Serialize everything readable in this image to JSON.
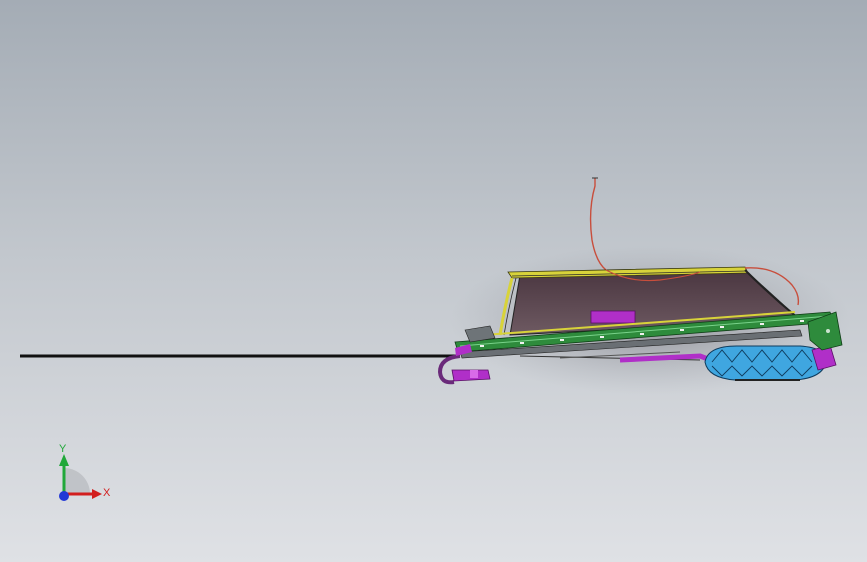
{
  "viewport": {
    "background_top": "#a4acb5",
    "background_bottom": "#dfe1e5"
  },
  "model": {
    "description_icon": "rope-winch-assembly",
    "colors": {
      "rail_yellow": "#d8d33a",
      "rail_green": "#2e8b3c",
      "purple": "#b02fc8",
      "blue": "#3fa6e0",
      "cable_red": "#c84e3c",
      "panel_dark": "#3a2a30"
    }
  },
  "triad": {
    "x_label": "X",
    "y_label": "Y",
    "x_color": "#d21e1e",
    "y_color": "#21a83a",
    "z_color": "#2238d6"
  }
}
